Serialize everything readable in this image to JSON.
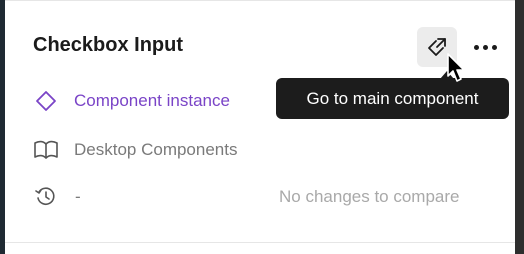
{
  "panel": {
    "title": "Checkbox Input",
    "goto_icon": "go-to-main-component-icon",
    "more_icon": "more-options-icon"
  },
  "tooltip": {
    "text": "Go to main component"
  },
  "rows": [
    {
      "icon": "component-instance-icon",
      "label": "Component instance"
    },
    {
      "icon": "library-book-icon",
      "label": "Desktop Components"
    },
    {
      "icon": "history-icon",
      "label": "-"
    }
  ],
  "history": {
    "status_text": "No changes to compare"
  },
  "colors": {
    "accent_purple": "#7a44c7",
    "tooltip_bg": "#1c1c1c",
    "muted_text": "#7a7a7a",
    "disabled_text": "#a9a9a9"
  }
}
